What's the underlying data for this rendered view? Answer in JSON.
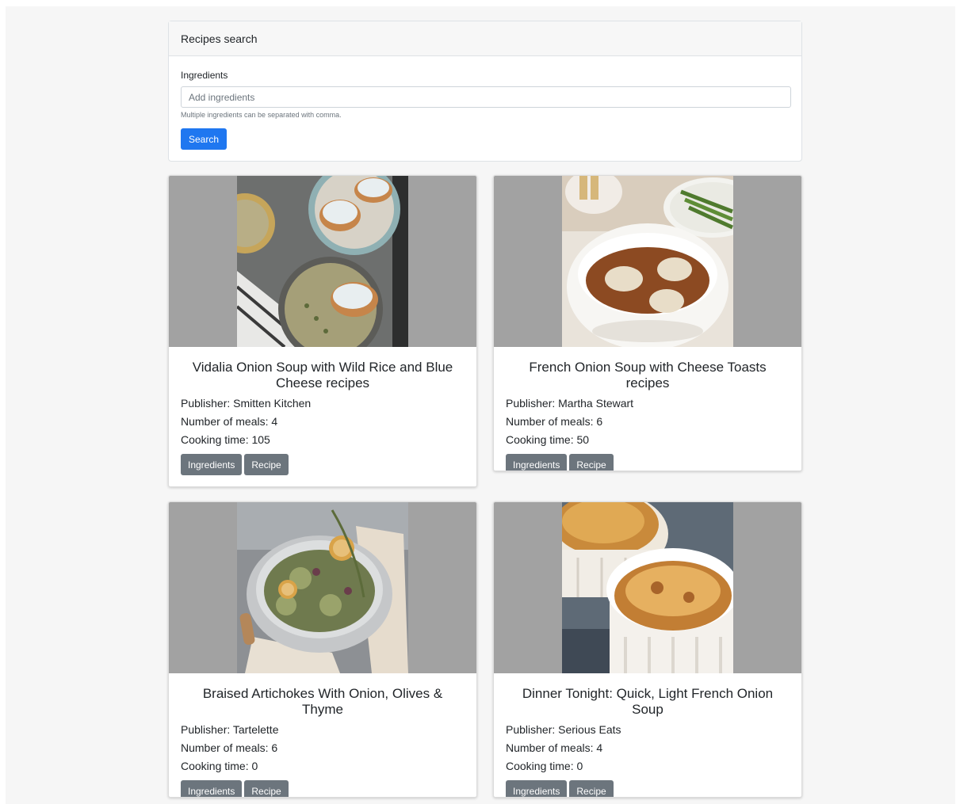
{
  "search": {
    "header": "Recipes search",
    "label": "Ingredients",
    "placeholder": "Add ingredients",
    "value": "",
    "help": "Multiple ingredients can be separated with comma.",
    "button": "Search"
  },
  "recipes": [
    {
      "title": "Vidalia Onion Soup with Wild Rice and Blue Cheese recipes",
      "publisher": "Publisher: Smitten Kitchen",
      "meals": "Number of meals: 4",
      "time": "Cooking time: 105",
      "ingredients_btn": "Ingredients",
      "recipe_btn": "Recipe"
    },
    {
      "title": "French Onion Soup with Cheese Toasts recipes",
      "publisher": "Publisher: Martha Stewart",
      "meals": "Number of meals: 6",
      "time": "Cooking time: 50",
      "ingredients_btn": "Ingredients",
      "recipe_btn": "Recipe"
    },
    {
      "title": "Braised Artichokes With Onion, Olives & Thyme",
      "publisher": "Publisher: Tartelette",
      "meals": "Number of meals: 6",
      "time": "Cooking time: 0",
      "ingredients_btn": "Ingredients",
      "recipe_btn": "Recipe"
    },
    {
      "title": "Dinner Tonight: Quick, Light French Onion Soup",
      "publisher": "Publisher: Serious Eats",
      "meals": "Number of meals: 4",
      "time": "Cooking time: 0",
      "ingredients_btn": "Ingredients",
      "recipe_btn": "Recipe"
    }
  ],
  "colors": {
    "primary": "#1f77f0",
    "secondary": "#6c757d",
    "image_letterbox": "#a2a2a2"
  }
}
